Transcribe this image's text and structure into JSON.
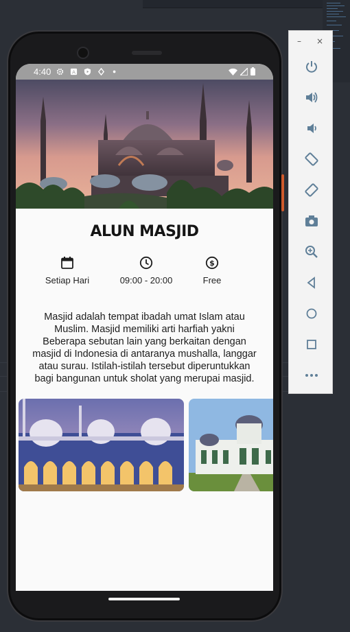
{
  "status_bar": {
    "time": "4:40"
  },
  "place": {
    "title": "ALUN MASJID",
    "info": [
      {
        "icon": "calendar-icon",
        "label": "Setiap Hari"
      },
      {
        "icon": "clock-icon",
        "label": "09:00 - 20:00"
      },
      {
        "icon": "dollar-icon",
        "label": "Free"
      }
    ],
    "description_lines": [
      "Masjid adalah tempat ibadah umat Islam atau",
      "Muslim. Masjid memiliki arti harfiah yakni",
      "Beberapa sebutan lain yang berkaitan dengan",
      "masjid di Indonesia di antaranya mushalla, langgar",
      "atau surau. Istilah-istilah tersebut diperuntukkan",
      "bagi bangunan untuk sholat yang merupai masjid."
    ]
  },
  "emulator_panel": {
    "window_controls": {
      "minimize": "–",
      "close": "×"
    },
    "controls": [
      "power-icon",
      "volume-up-icon",
      "volume-down-icon",
      "rotate-left-icon",
      "rotate-right-icon",
      "camera-icon",
      "zoom-icon",
      "back-icon",
      "home-icon",
      "overview-icon",
      "more-icon"
    ]
  },
  "colors": {
    "status_bar": "#9e9e9e",
    "screen_bg": "#fafafa",
    "emulator_icon": "#5f7f98",
    "accent_side_button": "#cf5a2c"
  }
}
